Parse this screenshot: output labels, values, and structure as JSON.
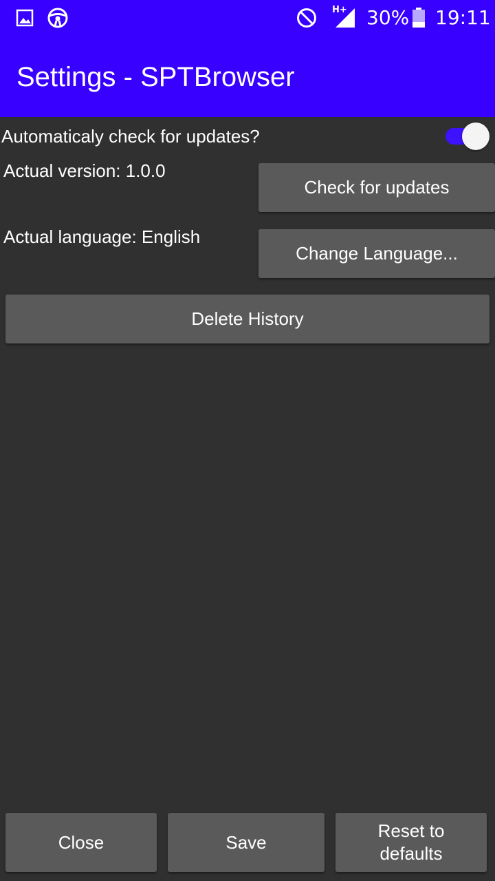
{
  "status_bar": {
    "icons": [
      "image-icon",
      "steering-wheel-icon",
      "do-not-disturb-icon",
      "signal-hplus-icon",
      "battery-icon"
    ],
    "network_label": "H+",
    "battery_percent": "30%",
    "battery_level": 0.3,
    "time": "19:11"
  },
  "app_bar": {
    "title": "Settings - SPTBrowser",
    "color": "#3700ff"
  },
  "settings": {
    "auto_update_label": "Automaticaly check for updates?",
    "auto_update_enabled": true,
    "version_label": "Actual version: 1.0.0",
    "check_updates_button": "Check for updates",
    "language_label": "Actual language: English",
    "change_language_button": "Change Language...",
    "delete_history_button": "Delete History"
  },
  "footer": {
    "close_button": "Close",
    "save_button": "Save",
    "reset_button": "Reset to defaults"
  },
  "colors": {
    "background": "#303030",
    "button": "#5a5a5a",
    "switch_track": "#3d12ff",
    "switch_thumb": "#f4f4f4"
  }
}
